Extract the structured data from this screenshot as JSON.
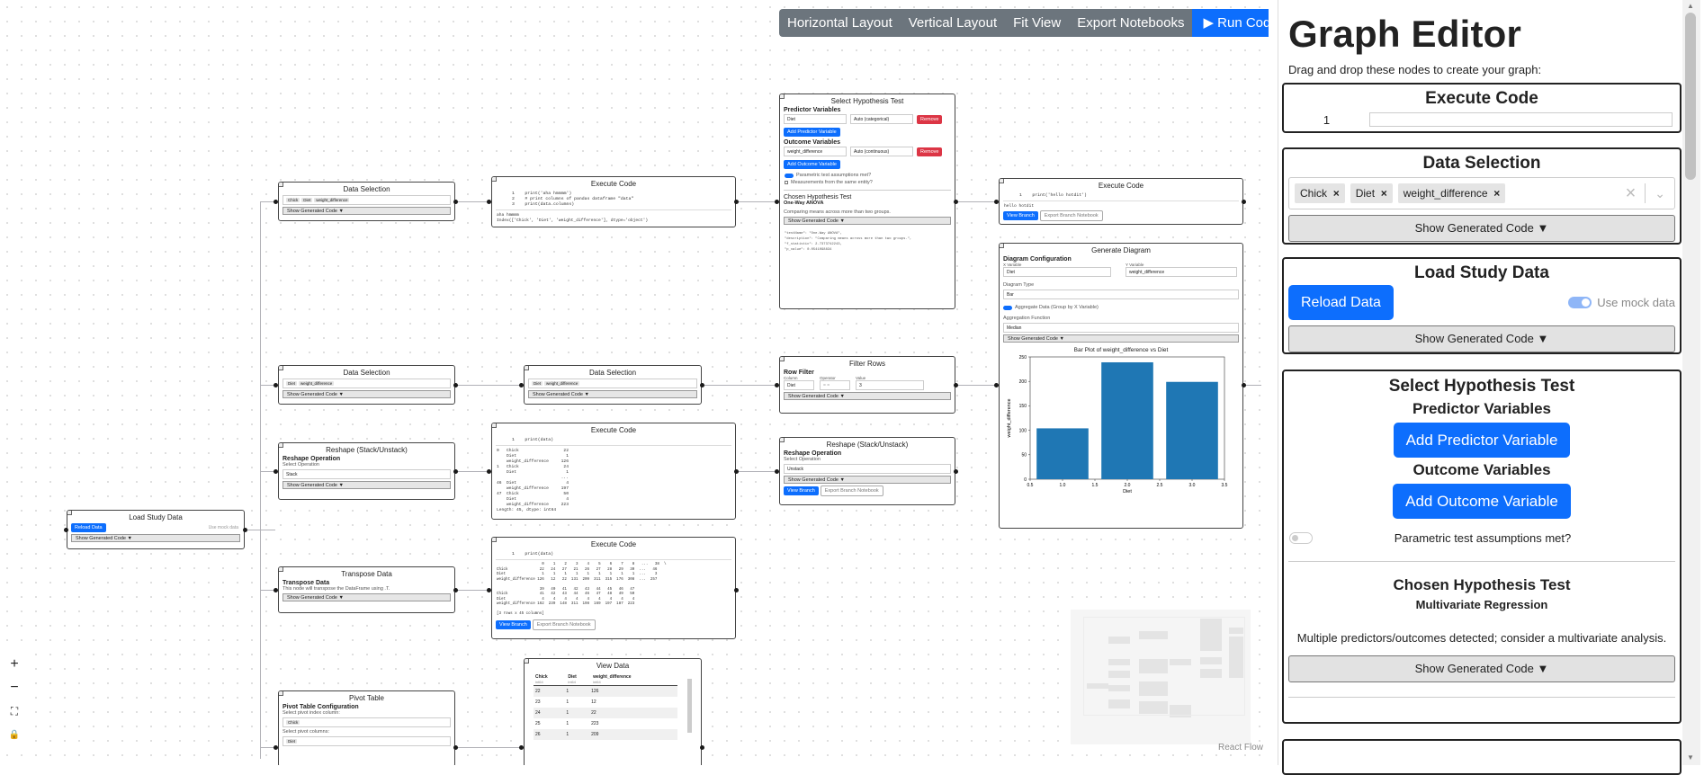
{
  "toolbar": {
    "horizontal": "Horizontal Layout",
    "vertical": "Vertical Layout",
    "fit": "Fit View",
    "export": "Export Notebooks",
    "run": "▶ Run Code"
  },
  "zoom_controls": {
    "plus": "+",
    "minus": "−",
    "fit": "⛶",
    "lock": "🔒"
  },
  "attribution": "React Flow",
  "canvas": {
    "load_node": {
      "title": "Load Study Data",
      "reload": "Reload Data",
      "mock": "Use mock data",
      "gen": "Show Generated Code ▼"
    },
    "ds1": {
      "title": "Data Selection",
      "chips": [
        "Chick",
        "Diet",
        "weight_difference"
      ],
      "gen": "Show Generated Code ▼"
    },
    "ds2": {
      "title": "Data Selection",
      "chips": [
        "Diet",
        "weight_difference"
      ],
      "gen": "Show Generated Code ▼"
    },
    "ds3": {
      "title": "Data Selection",
      "chips": [
        "Diet",
        "weight_difference"
      ],
      "gen": "Show Generated Code ▼"
    },
    "reshape1": {
      "title": "Reshape (Stack/Unstack)",
      "sub": "Reshape Operation",
      "lbl": "Select Operation",
      "value": "Stack",
      "gen": "Show Generated Code ▼"
    },
    "transpose": {
      "title": "Transpose Data",
      "sub": "Transpose Data",
      "lbl": "This node will transpose the DataFrame using .T.",
      "gen": "Show Generated Code ▼"
    },
    "pivot": {
      "title": "Pivot Table",
      "sub": "Pivot Table Configuration",
      "lbl1": "Select pivot index column:",
      "chip1": "Chick",
      "lbl2": "Select pivot columns:",
      "chip2": "Diet"
    },
    "exec1": {
      "title": "Execute Code",
      "code": "1    print('aha hmmmm')\n2    # print columns of pandas dataframe \"data\"\n3    print(data.columns)",
      "output": "aha hmmmm\nIndex(['Chick', 'Diet', 'weight_difference'], dtype='object')"
    },
    "exec2": {
      "title": "Execute Code",
      "code": "1    print(data)",
      "output": "0   Chick                  22\n    Diet                    1\n    weight_difference     126\n1   Chick                  24\n    Diet                    1\n                          ...\n46  Diet                    4\n    weight_difference     197\n47  Chick                  50\n    Diet                    4\n    weight_difference     223\nLength: 45, dtype: int64"
    },
    "exec3": {
      "title": "Execute Code",
      "code": "1    print(data)",
      "output": "                    0    1    2    3    4    5    6    7    8   ...   38  \\\nChick              22   24   27   21   26   27   28   29   30  ...   46\nDiet                1    1    1    1    1    1    1    1    1  ...    3\nweight_difference 126   12   22  131  209  311  315  176  308  ...  257\n\n                   39   40   41   42   43   44   45   46   47\nChick              41   42   43   44   46   47   48   49   50\nDiet                4    4    4    4    4    4    4    4    4\nweight_difference 162  239  148  311  198  169  197  187  223\n\n[3 rows x 45 columns]",
      "view": "View Branch",
      "export": "Export Branch Notebook"
    },
    "exec4": {
      "title": "Execute Code",
      "code": "1    print('hello hotdit')",
      "output": "hello hotdit",
      "view": "View Branch",
      "export": "Export Branch Notebook"
    },
    "view": {
      "title": "View Data",
      "headers": [
        "Chick",
        "Diet",
        "weight_difference"
      ],
      "types": [
        "int64",
        "int64",
        "int64"
      ],
      "rows": [
        [
          "22",
          "1",
          "126"
        ],
        [
          "23",
          "1",
          "12"
        ],
        [
          "24",
          "1",
          "22"
        ],
        [
          "25",
          "1",
          "223"
        ],
        [
          "26",
          "1",
          "209"
        ]
      ]
    },
    "hypo": {
      "title": "Select Hypothesis Test",
      "pred": "Predictor Variables",
      "pred_var": "Diet",
      "pred_type": "Auto (categorical)",
      "add_pred": "Add Predictor Variable",
      "outc": "Outcome Variables",
      "outc_var": "weight_difference",
      "outc_type": "Auto (continuous)",
      "add_outc": "Add Outcome Variable",
      "remove": "Remove",
      "param": "Parametric test assumptions met?",
      "repeat": "Measurements from the same entity?",
      "chosen": "Chosen Hypothesis Test",
      "test": "One-Way ANOVA",
      "desc": "Comparing means across more than two groups.",
      "gen": "Show Generated Code ▼",
      "json": "\"testName\": \"One-Way ANOVA\",\n\"description\": \"Comparing means across more than two groups.\",\n\"f_statistic\": 2.7373742243,\n\"p_value\": 0.0541098834"
    },
    "filter": {
      "title": "Filter Rows",
      "sub": "Row Filter",
      "col_lbl": "Column",
      "op_lbl": "Operator",
      "val_lbl": "Value",
      "col": "Diet",
      "op": "= =",
      "val": "3",
      "gen": "Show Generated Code ▼"
    },
    "reshape2": {
      "title": "Reshape (Stack/Unstack)",
      "sub": "Reshape Operation",
      "lbl": "Select Operation",
      "value": "Unstack",
      "gen": "Show Generated Code ▼",
      "view": "View Branch",
      "export": "Export Branch Notebook"
    },
    "diagram": {
      "title": "Generate Diagram",
      "sub": "Diagram Configuration",
      "xlbl": "X Variable",
      "ylbl": "Y Variable",
      "xval": "Diet",
      "yval": "weight_difference",
      "type_lbl": "Diagram Type",
      "type": "Bar",
      "agg_toggle": "Aggregate Data (Group by X Variable)",
      "agg_lbl": "Aggregation Function",
      "agg": "Median",
      "gen": "Show Generated Code ▼"
    }
  },
  "chart_data": {
    "type": "bar",
    "title": "Bar Plot of weight_difference vs Diet",
    "xlabel": "Diet",
    "ylabel": "weight_difference",
    "x": [
      1,
      2,
      3
    ],
    "values": [
      104,
      239,
      199
    ],
    "bar_color": "#1f77b4",
    "xlim": [
      0.5,
      3.5
    ],
    "ylim": [
      0,
      250
    ],
    "xticks": [
      "0.5",
      "1.0",
      "1.5",
      "2.0",
      "2.5",
      "3.0",
      "3.5"
    ],
    "yticks": [
      "0",
      "50",
      "100",
      "150",
      "200",
      "250"
    ]
  },
  "panel": {
    "title": "Graph Editor",
    "hint": "Drag and drop these nodes to create your graph:",
    "exec": {
      "title": "Execute Code",
      "line": "1"
    },
    "ds": {
      "title": "Data Selection",
      "chips": [
        "Chick",
        "Diet",
        "weight_difference"
      ],
      "gen": "Show Generated Code ▼"
    },
    "load": {
      "title": "Load Study Data",
      "reload": "Reload Data",
      "mock": "Use mock data",
      "gen": "Show Generated Code ▼"
    },
    "hypo": {
      "title": "Select Hypothesis Test",
      "pred": "Predictor Variables",
      "add_pred": "Add Predictor Variable",
      "outc": "Outcome Variables",
      "add_outc": "Add Outcome Variable",
      "param": "Parametric test assumptions met?",
      "chosen": "Chosen Hypothesis Test",
      "test": "Multivariate Regression",
      "desc": "Multiple predictors/outcomes detected; consider a multivariate analysis.",
      "gen": "Show Generated Code ▼"
    }
  },
  "colors": {
    "primary": "#0d6efd",
    "secondary": "#6c757d",
    "danger": "#dc3545",
    "bar": "#1f77b4"
  }
}
